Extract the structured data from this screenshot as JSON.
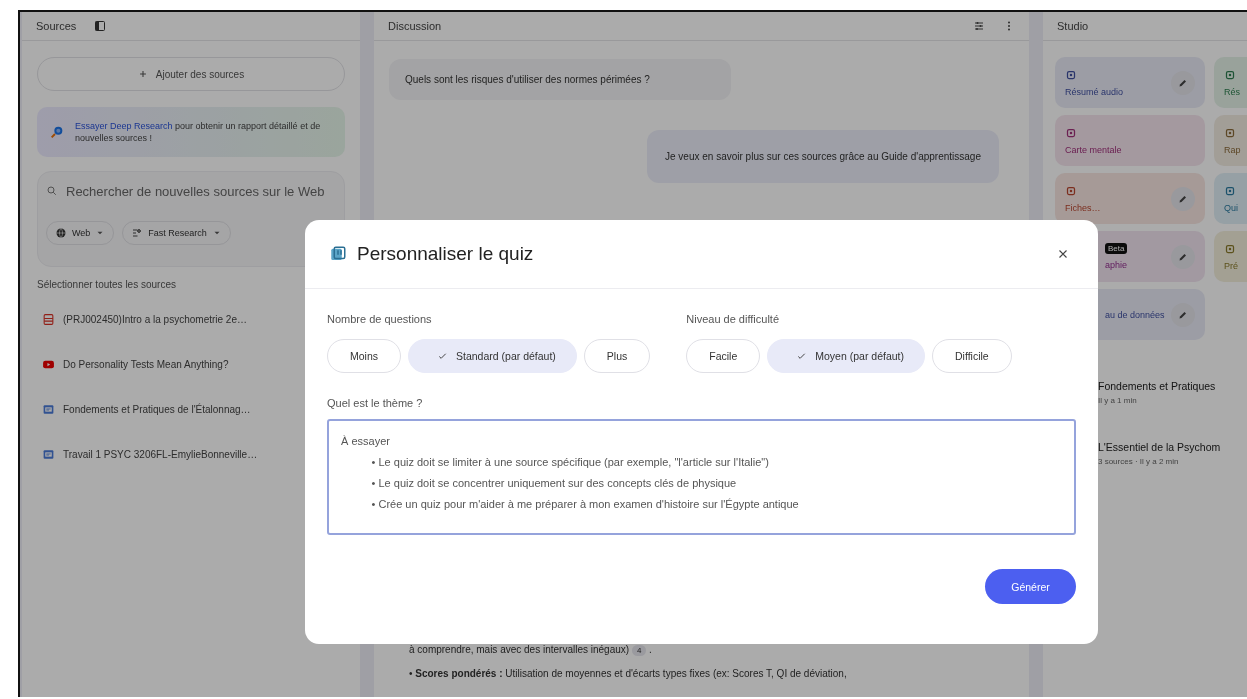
{
  "sources_panel": {
    "title": "Sources",
    "add_button": "Ajouter des sources",
    "banner": {
      "link": "Essayer Deep Research",
      "text": " pour obtenir un rapport détaillé et de nouvelles sources !"
    },
    "search": {
      "placeholder": "Rechercher de nouvelles sources sur le Web",
      "chips": [
        {
          "label": "Web",
          "kind": "globe"
        },
        {
          "label": "Fast Research",
          "kind": "research"
        }
      ]
    },
    "select_all": "Sélectionner toutes les sources",
    "sources": [
      {
        "title": "(PRJ002450)Intro a la psychometrie 2e…",
        "kind": "pdf"
      },
      {
        "title": "Do Personality Tests Mean Anything?",
        "kind": "video"
      },
      {
        "title": "Fondements et Pratiques de l'Étalonnag…",
        "kind": "doc"
      },
      {
        "title": "Travail 1 PSYC 3206FL-EmylieBonneville…",
        "kind": "doc"
      }
    ]
  },
  "chat_panel": {
    "title": "Discussion",
    "messages": [
      {
        "text": "Quels sont les risques d'utiliser des normes périmées ?",
        "kind": "suggestion"
      },
      {
        "text": "Je veux en savoir plus sur ces sources grâce au Guide d'apprentissage",
        "kind": "user"
      }
    ],
    "answer": [
      {
        "text": "à comprendre, mais avec des intervalles inégaux)",
        "citation": "4",
        "after": "."
      },
      {
        "text": "• **Scores pondérés :** Utilisation de moyennes et d'écarts types fixes (ex: Scores T, QI de déviation,"
      }
    ]
  },
  "studio_panel": {
    "title": "Studio",
    "tiles": [
      {
        "label": "Résumé audio",
        "editable": true,
        "kind": "audio",
        "partial": false
      },
      {
        "label": "Rés",
        "editable": false,
        "kind": "video",
        "partial": false
      },
      {
        "label": "Carte mentale",
        "editable": false,
        "kind": "mindmap",
        "partial": false
      },
      {
        "label": "Rap",
        "editable": false,
        "kind": "report",
        "partial": false
      },
      {
        "label": "Fiches…",
        "editable": true,
        "kind": "cards",
        "partial": false
      },
      {
        "label": "Qui",
        "editable": false,
        "kind": "quiz",
        "partial": false
      },
      {
        "label": "aphie",
        "badge": "Beta",
        "editable": true,
        "kind": "infographic",
        "partial": true
      },
      {
        "label": "Pré",
        "editable": false,
        "kind": "slides",
        "partial": false
      },
      {
        "label": "au de données",
        "editable": true,
        "kind": "table",
        "partial": true
      }
    ],
    "notes": [
      {
        "title": "Fondements et Pratiques",
        "meta": "Il y a 1 min"
      },
      {
        "title": "L'Essentiel de la Psychom",
        "meta": "3 sources · Il y a 2 min"
      }
    ]
  },
  "dialog": {
    "title": "Personnaliser le quiz",
    "groups": [
      {
        "label": "Nombre de questions",
        "options": [
          {
            "label": "Moins",
            "selected": false
          },
          {
            "label": "Standard (par défaut)",
            "selected": true
          },
          {
            "label": "Plus",
            "selected": false
          }
        ]
      },
      {
        "label": "Niveau de difficulté",
        "options": [
          {
            "label": "Facile",
            "selected": false
          },
          {
            "label": "Moyen (par défaut)",
            "selected": true
          },
          {
            "label": "Difficile",
            "selected": false
          }
        ]
      }
    ],
    "topic": {
      "label": "Quel est le thème ?",
      "placeholder": "À essayer\n          • Le quiz doit se limiter à une source spécifique (par exemple, \"l'article sur l'Italie\")\n          • Le quiz doit se concentrer uniquement sur des concepts clés de physique\n          • Crée un quiz pour m'aider à me préparer à mon examen d'histoire sur l'Égypte antique"
    },
    "submit": "Générer"
  }
}
